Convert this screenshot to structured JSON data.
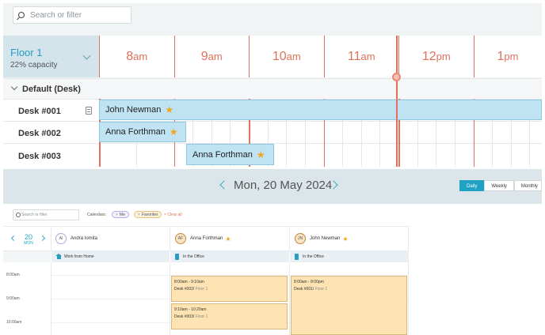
{
  "top": {
    "search_placeholder": "Search or filter",
    "floor": {
      "name": "Floor 1",
      "capacity": "22% capacity"
    },
    "hours": [
      {
        "num": "8",
        "suffix": "am"
      },
      {
        "num": "9",
        "suffix": "am"
      },
      {
        "num": "10",
        "suffix": "am"
      },
      {
        "num": "11",
        "suffix": "am"
      },
      {
        "num": "12",
        "suffix": "pm"
      },
      {
        "num": "1",
        "suffix": "pm"
      }
    ],
    "group": "Default (Desk)",
    "desks": [
      "Desk #001",
      "Desk #002",
      "Desk #003"
    ],
    "bookings": [
      "John Newman",
      "Anna Forthman",
      "Anna Forthman"
    ]
  },
  "calendar": {
    "date": "Mon, 20 May 2024",
    "views": [
      "Daily",
      "Weekly",
      "Monthly"
    ],
    "search_placeholder": "Search or filter",
    "calendars_label": "Calendars:",
    "chips": [
      "Me",
      "Favorites"
    ],
    "clear_all": "Clear all",
    "day": {
      "num": "20",
      "name": "MON"
    },
    "people": [
      {
        "initials": "AI",
        "name": "Andra Iomita",
        "status": "Work from Home"
      },
      {
        "initials": "AF",
        "name": "Anna Forthman",
        "status": "In the Office"
      },
      {
        "initials": "JN",
        "name": "John Newman",
        "status": "In the Office"
      }
    ],
    "times": [
      "8:00am",
      "9:00am",
      "10:00am"
    ],
    "events": [
      {
        "time": "8:00am - 9:10am",
        "desk": "Desk #002/",
        "floor": " Floor 1"
      },
      {
        "time": "9:10am - 10:20am",
        "desk": "Desk #003/",
        "floor": " Floor 1"
      },
      {
        "time": "8:00am - 8:00pm",
        "desk": "Desk #001/",
        "floor": " Floor 1"
      }
    ]
  },
  "colors": {
    "accent": "#1fa2c4",
    "hour_line": "#e0715a",
    "booking": "#bfe3f3",
    "event": "#ffe4b3"
  }
}
